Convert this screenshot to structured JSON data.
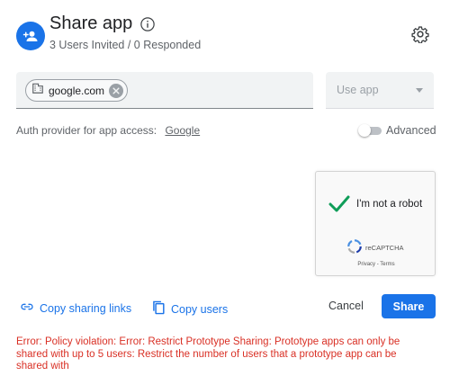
{
  "header": {
    "title": "Share app",
    "subtitle": "3 Users Invited / 0 Responded",
    "avatar_icon": "add-person-icon",
    "info_icon": "info-icon",
    "settings_icon": "gear-icon"
  },
  "domain_field": {
    "chip_label": "google.com",
    "chip_icon": "building-icon",
    "remove_icon": "close-circle-icon"
  },
  "access_select": {
    "placeholder": "Use app"
  },
  "auth": {
    "label": "Auth provider for app access:",
    "provider": "Google"
  },
  "advanced": {
    "label": "Advanced",
    "enabled": false
  },
  "captcha": {
    "label": "I'm not a robot",
    "checked": true,
    "brand": "reCAPTCHA",
    "terms": "Privacy - Terms"
  },
  "actions": {
    "copy_links": "Copy sharing links",
    "copy_users": "Copy users",
    "cancel": "Cancel",
    "share": "Share"
  },
  "error": "Error: Policy violation: Error: Restrict Prototype Sharing: Prototype apps can only be shared with up to 5 users: Restrict the number of users that a prototype app can be shared with",
  "colors": {
    "accent": "#1a73e8",
    "error": "#d93025",
    "check": "#0f9d58"
  }
}
